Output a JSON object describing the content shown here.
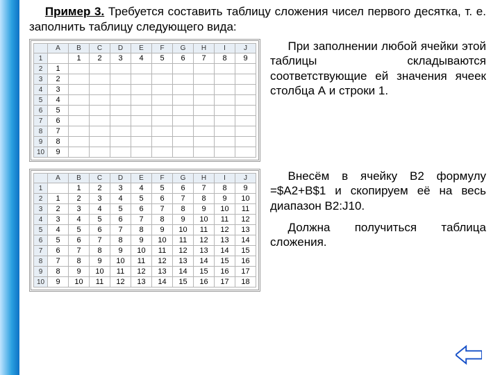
{
  "title_strong": "Пример 3.",
  "title_rest": " Требуется составить таблицу сложения чисел первого десятка, т. е. заполнить таблицу следующего вида:",
  "para1": "При заполнении любой ячейки этой таблицы складываются соответствующие ей значения ячеек столбца А и строки 1.",
  "para2": "Внесём в ячейку В2 формулу =$A2+B$1 и скопируем её на весь диапазон В2:J10.",
  "para3": "Должна получиться таблица сложения.",
  "columns": [
    "A",
    "B",
    "C",
    "D",
    "E",
    "F",
    "G",
    "H",
    "I",
    "J"
  ],
  "rows": [
    "1",
    "2",
    "3",
    "4",
    "5",
    "6",
    "7",
    "8",
    "9",
    "10"
  ],
  "table_empty": [
    [
      "",
      "1",
      "2",
      "3",
      "4",
      "5",
      "6",
      "7",
      "8",
      "9"
    ],
    [
      "1",
      "",
      "",
      "",
      "",
      "",
      "",
      "",
      "",
      ""
    ],
    [
      "2",
      "",
      "",
      "",
      "",
      "",
      "",
      "",
      "",
      ""
    ],
    [
      "3",
      "",
      "",
      "",
      "",
      "",
      "",
      "",
      "",
      ""
    ],
    [
      "4",
      "",
      "",
      "",
      "",
      "",
      "",
      "",
      "",
      ""
    ],
    [
      "5",
      "",
      "",
      "",
      "",
      "",
      "",
      "",
      "",
      ""
    ],
    [
      "6",
      "",
      "",
      "",
      "",
      "",
      "",
      "",
      "",
      ""
    ],
    [
      "7",
      "",
      "",
      "",
      "",
      "",
      "",
      "",
      "",
      ""
    ],
    [
      "8",
      "",
      "",
      "",
      "",
      "",
      "",
      "",
      "",
      ""
    ],
    [
      "9",
      "",
      "",
      "",
      "",
      "",
      "",
      "",
      "",
      ""
    ]
  ],
  "table_filled": [
    [
      "",
      "1",
      "2",
      "3",
      "4",
      "5",
      "6",
      "7",
      "8",
      "9"
    ],
    [
      "1",
      "2",
      "3",
      "4",
      "5",
      "6",
      "7",
      "8",
      "9",
      "10"
    ],
    [
      "2",
      "3",
      "4",
      "5",
      "6",
      "7",
      "8",
      "9",
      "10",
      "11"
    ],
    [
      "3",
      "4",
      "5",
      "6",
      "7",
      "8",
      "9",
      "10",
      "11",
      "12"
    ],
    [
      "4",
      "5",
      "6",
      "7",
      "8",
      "9",
      "10",
      "11",
      "12",
      "13"
    ],
    [
      "5",
      "6",
      "7",
      "8",
      "9",
      "10",
      "11",
      "12",
      "13",
      "14"
    ],
    [
      "6",
      "7",
      "8",
      "9",
      "10",
      "11",
      "12",
      "13",
      "14",
      "15"
    ],
    [
      "7",
      "8",
      "9",
      "10",
      "11",
      "12",
      "13",
      "14",
      "15",
      "16"
    ],
    [
      "8",
      "9",
      "10",
      "11",
      "12",
      "13",
      "14",
      "15",
      "16",
      "17"
    ],
    [
      "9",
      "10",
      "11",
      "12",
      "13",
      "14",
      "15",
      "16",
      "17",
      "18"
    ]
  ]
}
